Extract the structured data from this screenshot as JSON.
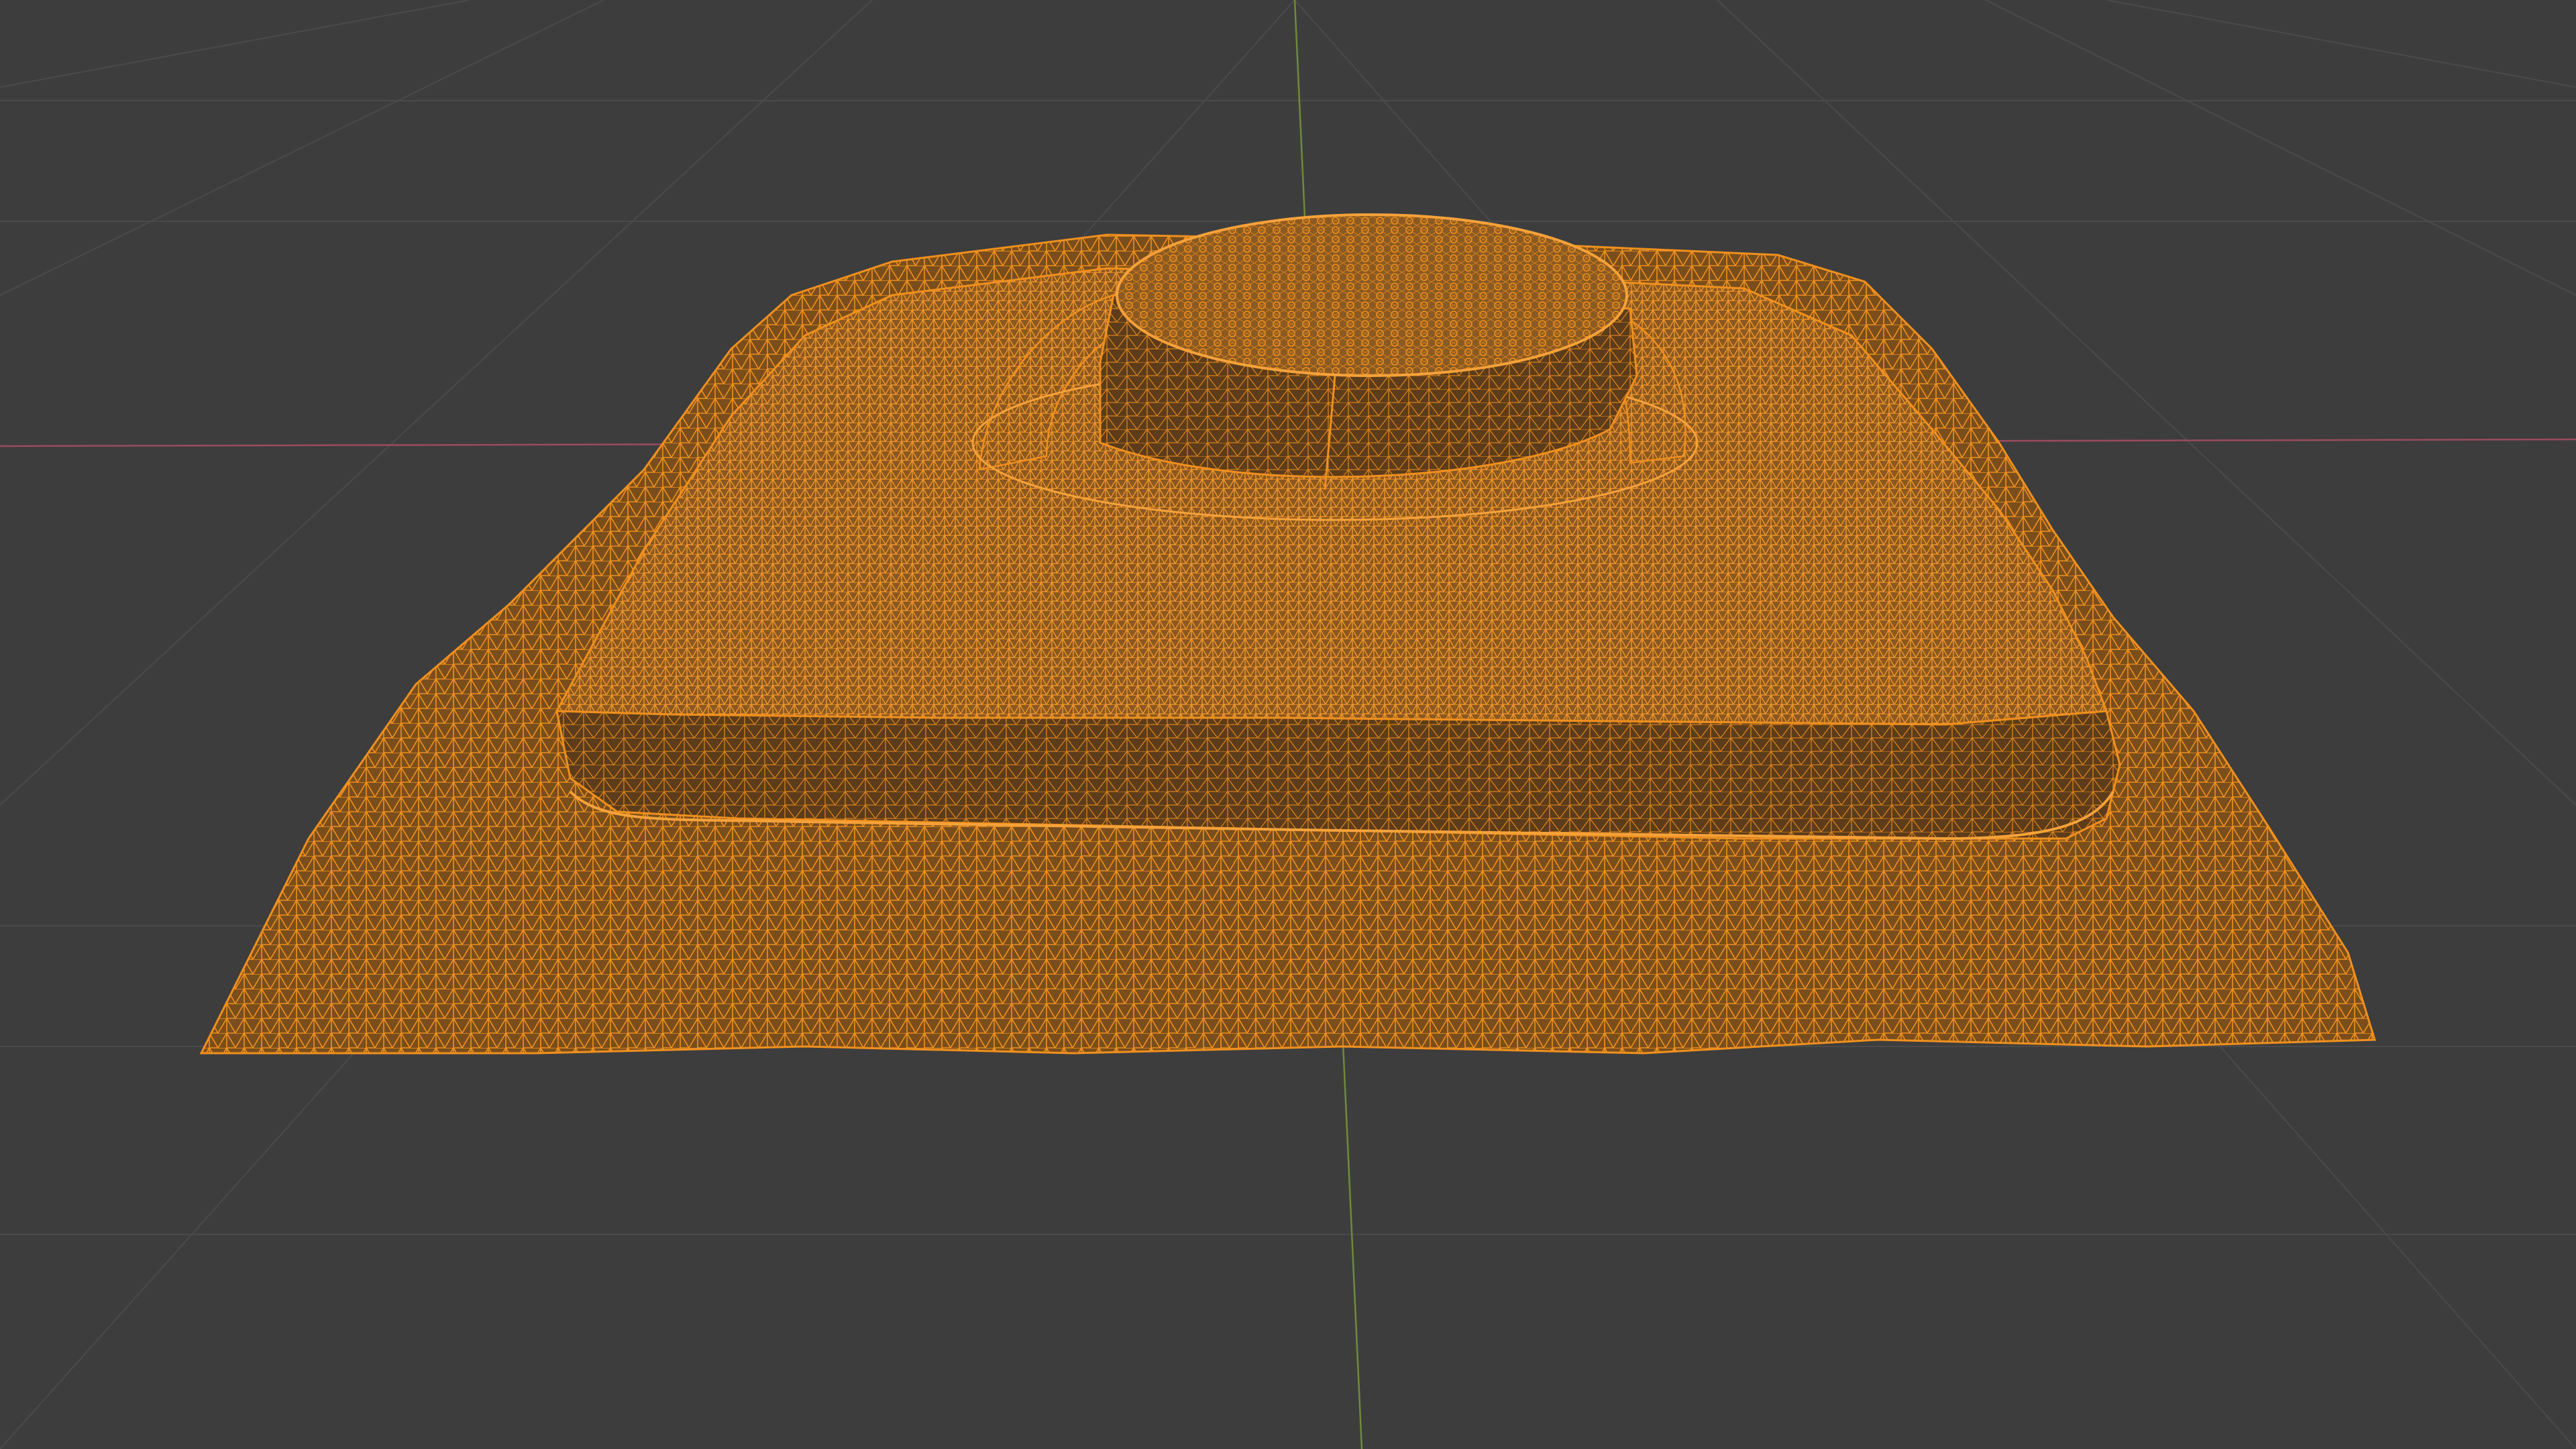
{
  "viewport": {
    "mode": "3d-viewport",
    "display": "wireframe",
    "background_color": "#3d3d3d",
    "grid_color": "#4a4a4a",
    "x_axis_color": "#9b4b5c",
    "y_axis_color": "#6f8a3a",
    "selection_color": "#f0901e"
  },
  "object": {
    "name_icon": "mesh-wireframe",
    "shape": "square base slab with raised cylindrical cap",
    "selected": true
  }
}
